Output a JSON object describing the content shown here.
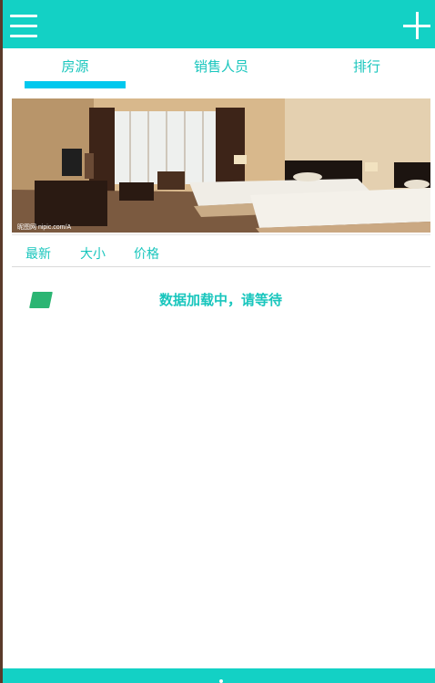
{
  "header": {
    "menu_icon": "hamburger-menu-icon",
    "add_icon": "plus-icon",
    "color": "#13d1c5"
  },
  "tabs": [
    {
      "label": "房源",
      "active": true
    },
    {
      "label": "销售人员",
      "active": false
    },
    {
      "label": "排行",
      "active": false
    }
  ],
  "banner": {
    "watermark": "昵图网 nipic.com/A"
  },
  "sort": {
    "latest": "最新",
    "size": "大小",
    "price": "价格"
  },
  "status": {
    "loading": "数据加载中，请等待"
  },
  "colors": {
    "accent": "#13d1c5",
    "indicator": "#00c8ee",
    "text_accent": "#19c6bd",
    "loader": "#2bb573"
  }
}
